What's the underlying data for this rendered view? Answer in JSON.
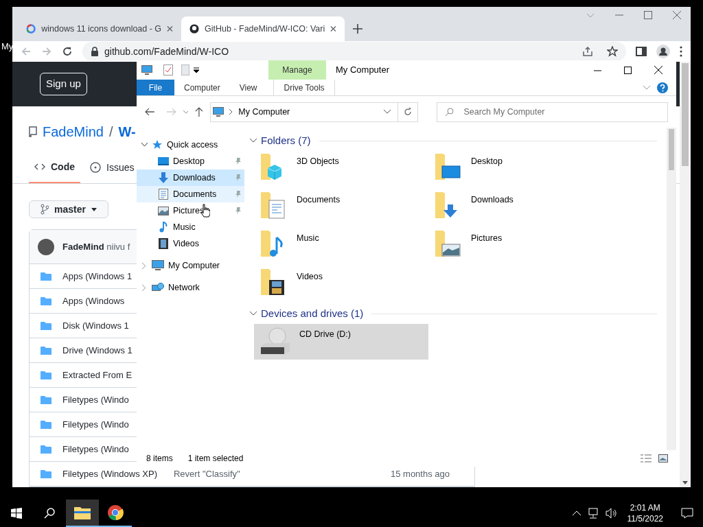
{
  "desktop": {
    "icon_label": "My"
  },
  "browser": {
    "tabs": [
      {
        "title": "windows 11 icons download - G",
        "kind": "google",
        "selected": false
      },
      {
        "title": "GitHub - FadeMind/W-ICO: Vari",
        "kind": "github",
        "selected": true
      }
    ],
    "url": "github.com/FadeMind/W-ICO"
  },
  "github": {
    "sign_up": "Sign up",
    "owner": "FadeMind",
    "separator": "/",
    "repo": "W-",
    "nav_tabs": [
      {
        "label": "Code",
        "selected": true
      },
      {
        "label": "Issues",
        "selected": false
      }
    ],
    "branch": "master",
    "commit_author": "FadeMind",
    "commit_message": "niivu f",
    "rows": [
      {
        "name": "Apps (Windows 1"
      },
      {
        "name": "Apps (Windows"
      },
      {
        "name": "Disk (Windows 1"
      },
      {
        "name": "Drive (Windows 1"
      },
      {
        "name": "Extracted From E"
      },
      {
        "name": "Filetypes (Windo"
      },
      {
        "name": "Filetypes (Windo"
      },
      {
        "name": "Filetypes (Windo"
      },
      {
        "name": "Filetypes (Windows XP)",
        "message": "Revert \"Classify\"",
        "age": "15 months ago"
      }
    ]
  },
  "explorer": {
    "title": "My Computer",
    "context_group": "Manage",
    "ribbon_tabs": [
      {
        "label": "File",
        "kind": "file"
      },
      {
        "label": "Computer",
        "kind": "tab"
      },
      {
        "label": "View",
        "kind": "tab"
      },
      {
        "label": "Drive Tools",
        "kind": "context"
      }
    ],
    "address": "My Computer",
    "search": {
      "placeholder": "Search My Computer"
    },
    "nav": [
      {
        "label": "Quick access",
        "kind": "star",
        "expanded": true,
        "children": [
          {
            "label": "Desktop",
            "kind": "desktop",
            "pinned": true,
            "selected": false,
            "hovered": false
          },
          {
            "label": "Downloads",
            "kind": "downloads",
            "pinned": true,
            "selected": true,
            "hovered": false
          },
          {
            "label": "Documents",
            "kind": "documents",
            "pinned": true,
            "selected": false,
            "hovered": true
          },
          {
            "label": "Pictures",
            "kind": "pictures",
            "pinned": true,
            "selected": false,
            "hovered": false
          },
          {
            "label": "Music",
            "kind": "music",
            "pinned": false,
            "selected": false,
            "hovered": false
          },
          {
            "label": "Videos",
            "kind": "videos",
            "pinned": false,
            "selected": false,
            "hovered": false
          }
        ]
      },
      {
        "label": "My Computer",
        "kind": "computer",
        "expanded": false
      },
      {
        "label": "Network",
        "kind": "network",
        "expanded": false
      }
    ],
    "groups": [
      {
        "title": "Folders (7)",
        "expanded": true,
        "items": [
          {
            "label": "3D Objects",
            "kind": "objects",
            "selected": false
          },
          {
            "label": "Desktop",
            "kind": "desktop",
            "selected": false
          },
          {
            "label": "Documents",
            "kind": "documents",
            "selected": false
          },
          {
            "label": "Downloads",
            "kind": "downloads",
            "selected": false
          },
          {
            "label": "Music",
            "kind": "music",
            "selected": false
          },
          {
            "label": "Pictures",
            "kind": "pictures",
            "selected": false
          },
          {
            "label": "Videos",
            "kind": "videos",
            "selected": false
          }
        ]
      },
      {
        "title": "Devices and drives (1)",
        "expanded": true,
        "items": [
          {
            "label": "CD Drive (D:)",
            "kind": "cd",
            "selected": true
          }
        ]
      }
    ],
    "status": {
      "count": "8 items",
      "selection": "1 item selected"
    }
  },
  "taskbar": {
    "apps": [
      {
        "kind": "explorer",
        "selected": true
      },
      {
        "kind": "chrome",
        "selected": false
      }
    ],
    "time": "2:01 AM",
    "date": "11/5/2022"
  }
}
